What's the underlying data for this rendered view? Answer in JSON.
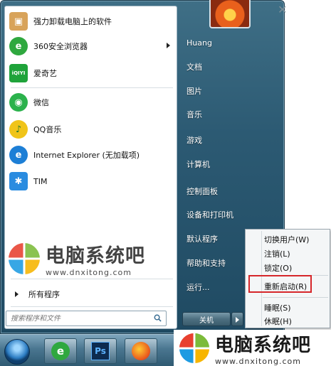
{
  "programs": [
    {
      "label": "强力卸载电脑上的软件",
      "icon": "uninstaller-icon",
      "color": "#d8a35a"
    },
    {
      "label": "360安全浏览器",
      "icon": "360-browser-icon",
      "color": "#2fa83f",
      "has_submenu": true
    },
    {
      "label": "爱奇艺",
      "icon": "iqiyi-icon",
      "color": "#1fa33a",
      "glyph": "iQIYI"
    },
    {
      "label": "微信",
      "icon": "wechat-icon",
      "color": "#2bb24c"
    },
    {
      "label": "QQ音乐",
      "icon": "qq-music-icon",
      "color": "#f0c419"
    },
    {
      "label": "Internet Explorer (无加载项)",
      "icon": "internet-explorer-icon",
      "color": "#1d7fd6"
    },
    {
      "label": "TIM",
      "icon": "tim-icon",
      "color": "#2a8ce0"
    }
  ],
  "all_programs_label": "所有程序",
  "search": {
    "placeholder": "搜索程序和文件"
  },
  "right_pane": {
    "items": [
      "Huang",
      "文档",
      "图片",
      "音乐",
      "游戏",
      "计算机",
      "控制面板",
      "设备和打印机",
      "默认程序",
      "帮助和支持",
      "运行..."
    ]
  },
  "shutdown": {
    "label": "关机"
  },
  "power_menu": {
    "items": [
      "切换用户(W)",
      "注销(L)",
      "锁定(O)",
      "重新启动(R)",
      "睡眠(S)",
      "休眠(H)"
    ],
    "highlighted": "重新启动(R)",
    "highlight_color": "#d6262a"
  },
  "watermark": {
    "name": "电脑系统吧",
    "url": "www.dnxitong.com"
  },
  "taskbar": {
    "apps": [
      "360-browser-icon",
      "photoshop-icon",
      "firefox-icon"
    ],
    "ps_label": "Ps"
  }
}
